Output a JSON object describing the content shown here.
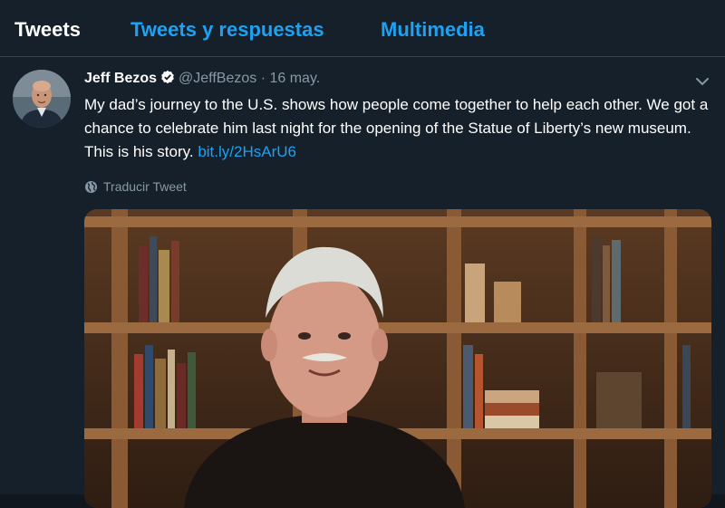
{
  "tabs": [
    {
      "label": "Tweets",
      "active": true
    },
    {
      "label": "Tweets y respuestas",
      "active": false
    },
    {
      "label": "Multimedia",
      "active": false
    }
  ],
  "tweet": {
    "author_name": "Jeff Bezos",
    "handle": "@JeffBezos",
    "separator": "·",
    "date": "16 may.",
    "text_before_link": "My dad’s journey to the U.S. shows how people come together to help each other. We got a chance to celebrate him last night for the opening of the Statue of Liberty’s new museum. This is his story.",
    "link": "bit.ly/2HsArU6",
    "translate_label": "Traducir Tweet",
    "icons": {
      "verified": "verified-badge-icon",
      "chevron": "chevron-down-icon",
      "translate": "globe-icon"
    }
  },
  "colors": {
    "background": "#15202b",
    "accent": "#1da1f2",
    "secondary_text": "#8899a6",
    "divider": "#38444d"
  }
}
